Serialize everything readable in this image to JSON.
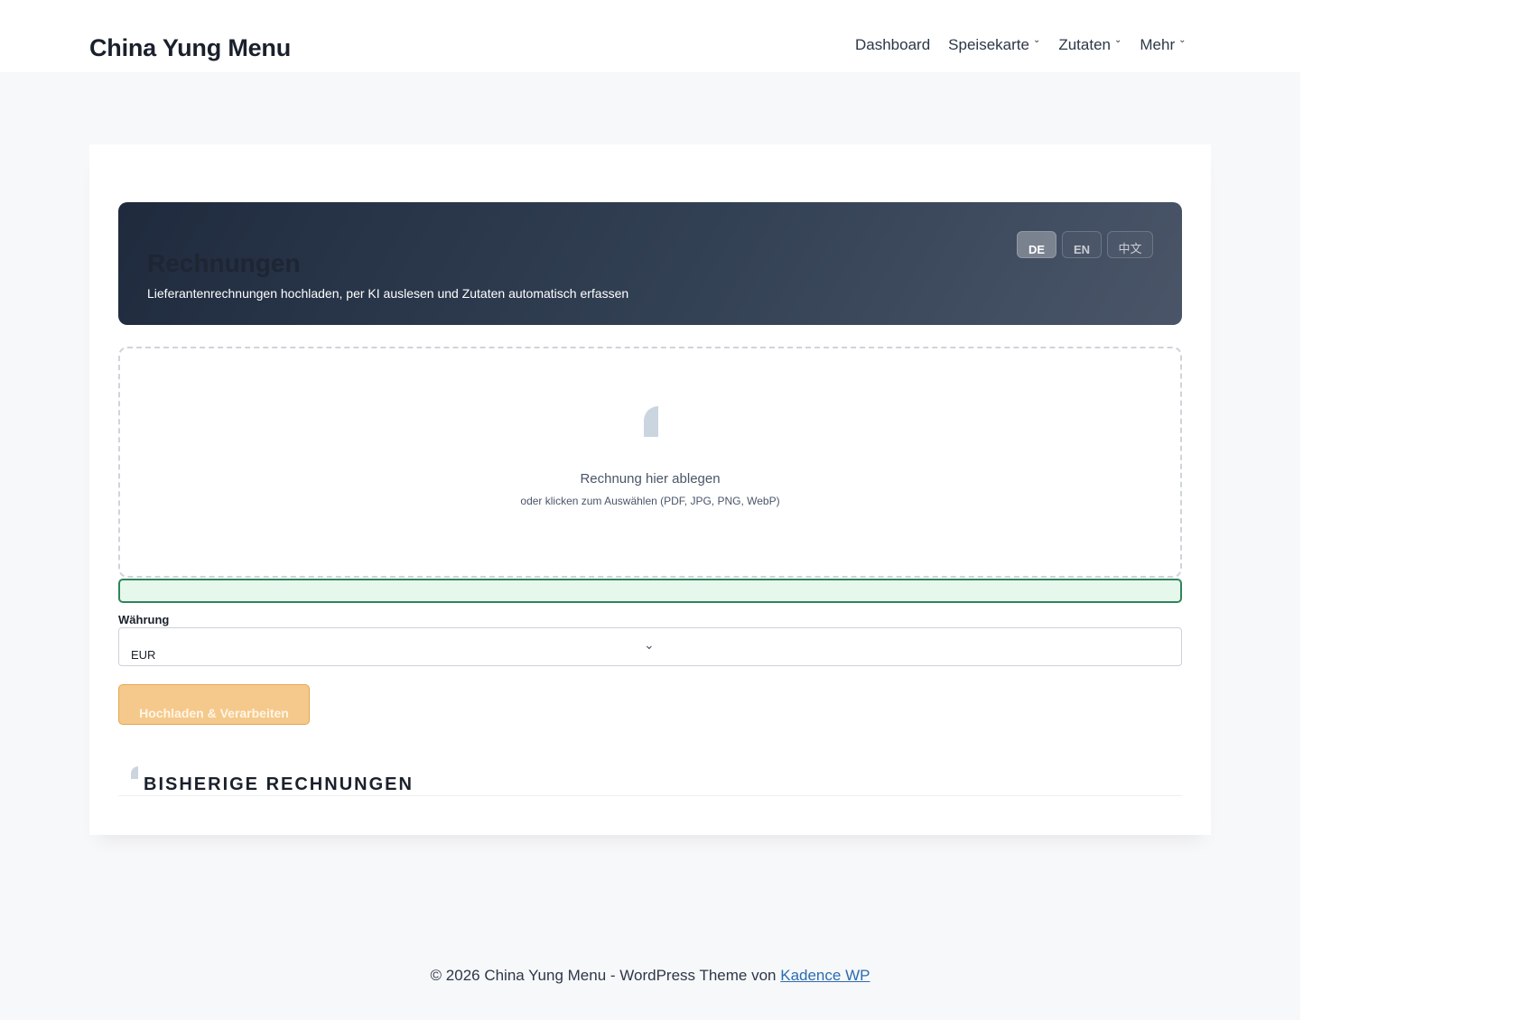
{
  "header": {
    "brand": "China Yung Menu",
    "nav": [
      {
        "label": "Dashboard",
        "has_dropdown": false
      },
      {
        "label": "Speisekarte",
        "has_dropdown": true
      },
      {
        "label": "Zutaten",
        "has_dropdown": true
      },
      {
        "label": "Mehr",
        "has_dropdown": true
      }
    ]
  },
  "hero": {
    "title": "Rechnungen",
    "subtitle": "Lieferantenrechnungen hochladen, per KI auslesen und Zutaten automatisch erfassen",
    "languages": [
      "DE",
      "EN",
      "中文"
    ],
    "active_language": "DE"
  },
  "upload": {
    "title": "Rechnung hier ablegen",
    "hint": "oder klicken zum Auswählen (PDF, JPG, PNG, WebP)"
  },
  "currency": {
    "label": "Währung",
    "value": "EUR"
  },
  "submit_label": "Hochladen & Verarbeiten",
  "history": {
    "title": "BISHERIGE RECHNUNGEN"
  },
  "footer": {
    "text": "© 2026 China Yung Menu - WordPress Theme von ",
    "link": "Kadence WP"
  },
  "colors": {
    "accent": "#f5c98b",
    "success": "#2f855a",
    "hero_dark": "#1f2a3d"
  }
}
